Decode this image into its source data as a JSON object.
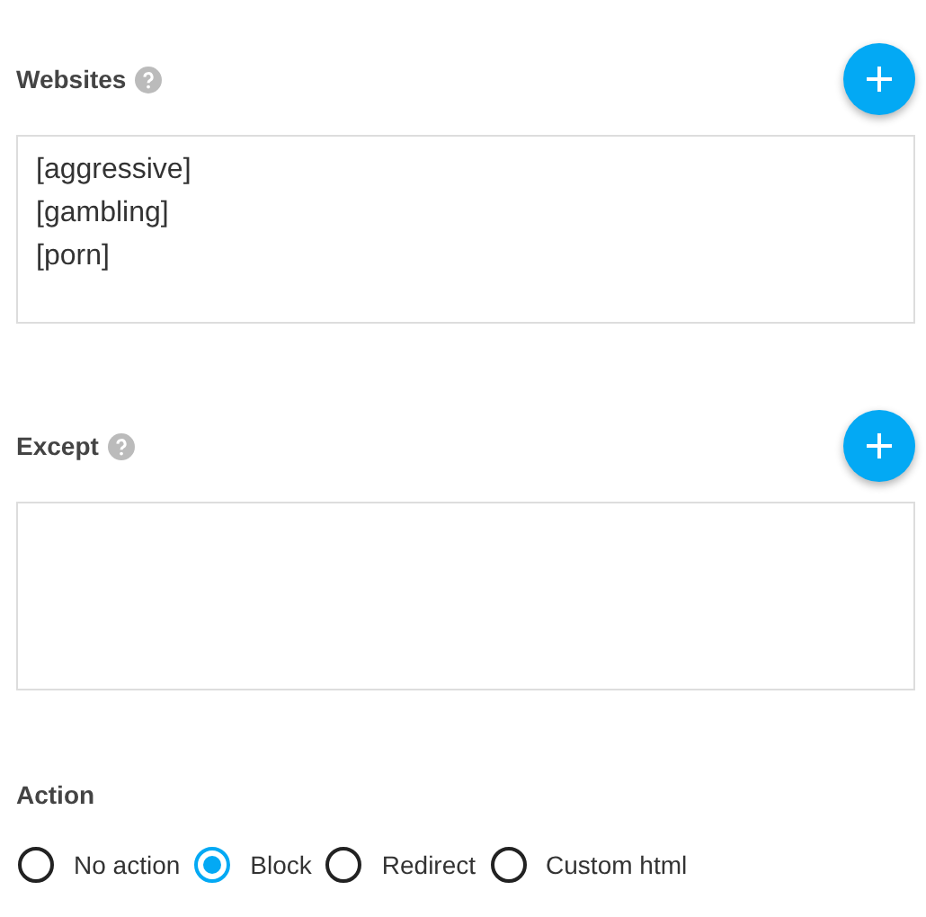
{
  "sections": [
    {
      "title": "Websites",
      "entries": [
        "[aggressive]",
        "[gambling]",
        "[porn]"
      ]
    },
    {
      "title": "Except"
    }
  ],
  "action": {
    "title": "Action",
    "options": [
      {
        "label": "No action",
        "selected": false
      },
      {
        "label": "Block",
        "selected": true
      },
      {
        "label": "Redirect",
        "selected": false
      },
      {
        "label": "Custom html",
        "selected": false
      }
    ]
  }
}
